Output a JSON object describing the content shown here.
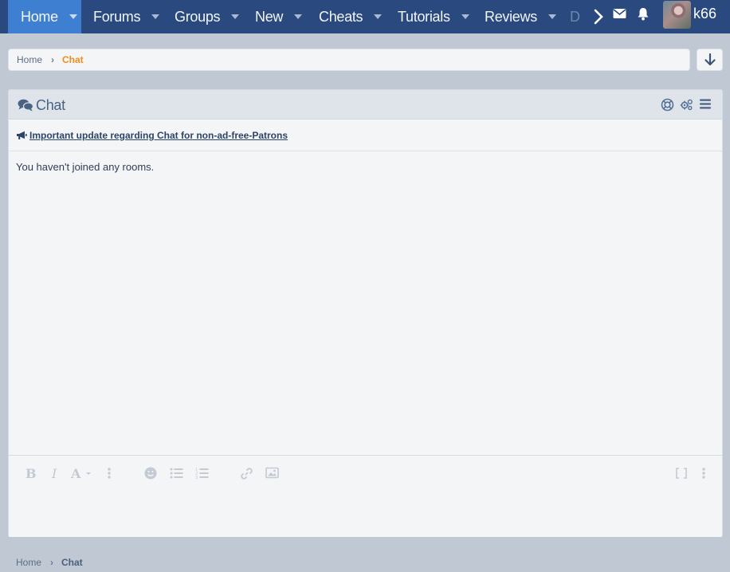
{
  "nav": {
    "tabs": [
      {
        "label": "Home"
      },
      {
        "label": "Forums"
      },
      {
        "label": "Groups"
      },
      {
        "label": "New"
      },
      {
        "label": "Cheats"
      },
      {
        "label": "Tutorials"
      },
      {
        "label": "Reviews"
      },
      {
        "label": "D"
      }
    ],
    "username": "k66"
  },
  "breadcrumb": {
    "items": [
      "Home",
      "Chat"
    ]
  },
  "chat": {
    "title": "Chat",
    "notice": "Important update regarding Chat for non-ad-free-Patrons",
    "empty_message": "You haven't joined any rooms."
  },
  "footer_breadcrumb": {
    "items": [
      "Home",
      "Chat"
    ]
  },
  "colors": {
    "navbar": "#2a4a7f",
    "active_tab": "#3f7fd1",
    "current_crumb": "#f08c1e",
    "page_bg": "#bfc8d3"
  }
}
